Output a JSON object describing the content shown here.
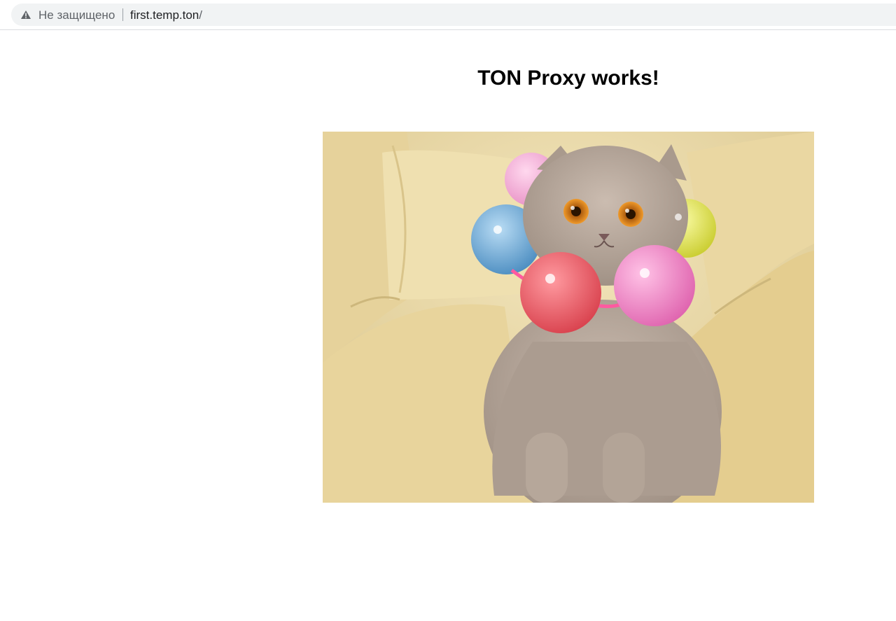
{
  "browser": {
    "security_label": "Не защищено",
    "url_host": "first.temp.ton",
    "url_path": "/"
  },
  "page": {
    "title": "TON Proxy works!",
    "image": {
      "subject": "cat-with-balloons-photo"
    }
  },
  "colors": {
    "omnibox_bg": "#f1f3f4",
    "sofa": "#e9d6a0",
    "cat_fur": "#b7a89c",
    "balloon_pink": "#f07fc0",
    "balloon_red": "#ec5a63",
    "balloon_blue": "#6aa8d6",
    "balloon_yellow": "#e6e85a",
    "balloon_green": "#4caa4a",
    "eye_orange": "#e08a1e"
  }
}
